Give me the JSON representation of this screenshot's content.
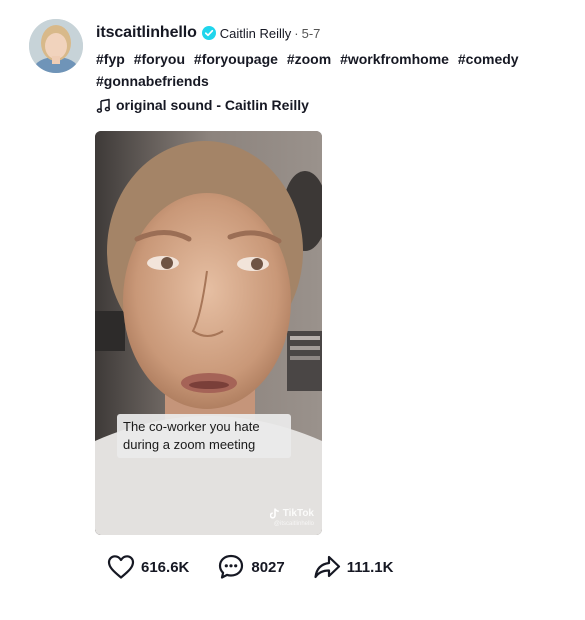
{
  "post": {
    "username": "itscaitlinhello",
    "display_name": "Caitlin Reilly",
    "separator": "·",
    "date": "5-7",
    "hashtags": [
      "#fyp",
      "#foryou",
      "#foryoupage",
      "#zoom",
      "#workfromhome",
      "#comedy",
      "#gonnabefriends"
    ],
    "sound": "original sound - Caitlin Reilly"
  },
  "video": {
    "subtitle_line1": "The co-worker you hate",
    "subtitle_line2": "during a zoom meeting",
    "watermark_brand": "TikTok",
    "watermark_handle": "@itscaitlinhello"
  },
  "actions": {
    "likes": "616.6K",
    "comments": "8027",
    "shares": "111.1K"
  },
  "icons": {
    "verified": "verified-badge-icon",
    "music": "music-note-icon",
    "like": "heart-icon",
    "comment": "comment-icon",
    "share": "share-arrow-icon"
  },
  "colors": {
    "verified_badge": "#20d5ec",
    "text": "#161823"
  }
}
